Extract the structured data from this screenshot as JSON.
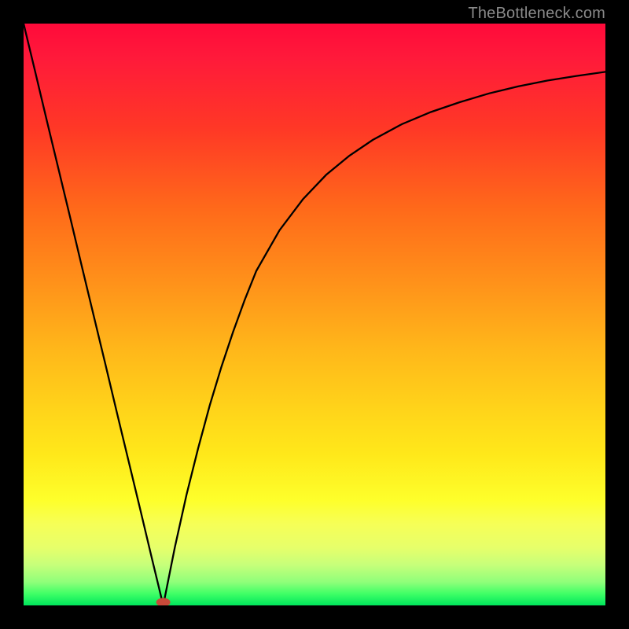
{
  "watermark": "TheBottleneck.com",
  "chart_data": {
    "type": "line",
    "title": "",
    "xlabel": "",
    "ylabel": "",
    "xlim": [
      0,
      100
    ],
    "ylim": [
      0,
      100
    ],
    "grid": false,
    "legend": false,
    "annotations": [],
    "series": [
      {
        "name": "bottleneck-curve",
        "x": [
          0,
          2,
          4,
          6,
          8,
          10,
          12,
          14,
          16,
          18,
          20,
          22,
          24,
          26,
          28,
          30,
          32,
          34,
          36,
          38,
          40,
          44,
          48,
          52,
          56,
          60,
          65,
          70,
          75,
          80,
          85,
          90,
          95,
          100
        ],
        "y": [
          100,
          91.7,
          83.3,
          75.0,
          66.7,
          58.3,
          50.0,
          41.7,
          33.3,
          25.0,
          16.7,
          8.3,
          0.0,
          10.0,
          19.0,
          27.0,
          34.4,
          41.0,
          47.0,
          52.5,
          57.5,
          64.5,
          69.8,
          74.0,
          77.3,
          80.0,
          82.7,
          84.8,
          86.5,
          88.0,
          89.2,
          90.2,
          91.0,
          91.7
        ]
      }
    ],
    "marker": {
      "x": 24,
      "y": 0,
      "label": "optimal-point"
    },
    "background_gradient": {
      "stops": [
        {
          "pos": 0.0,
          "color": "#ff0a3a"
        },
        {
          "pos": 0.5,
          "color": "#ffb71a"
        },
        {
          "pos": 0.82,
          "color": "#feff2b"
        },
        {
          "pos": 1.0,
          "color": "#00e65c"
        }
      ]
    }
  }
}
